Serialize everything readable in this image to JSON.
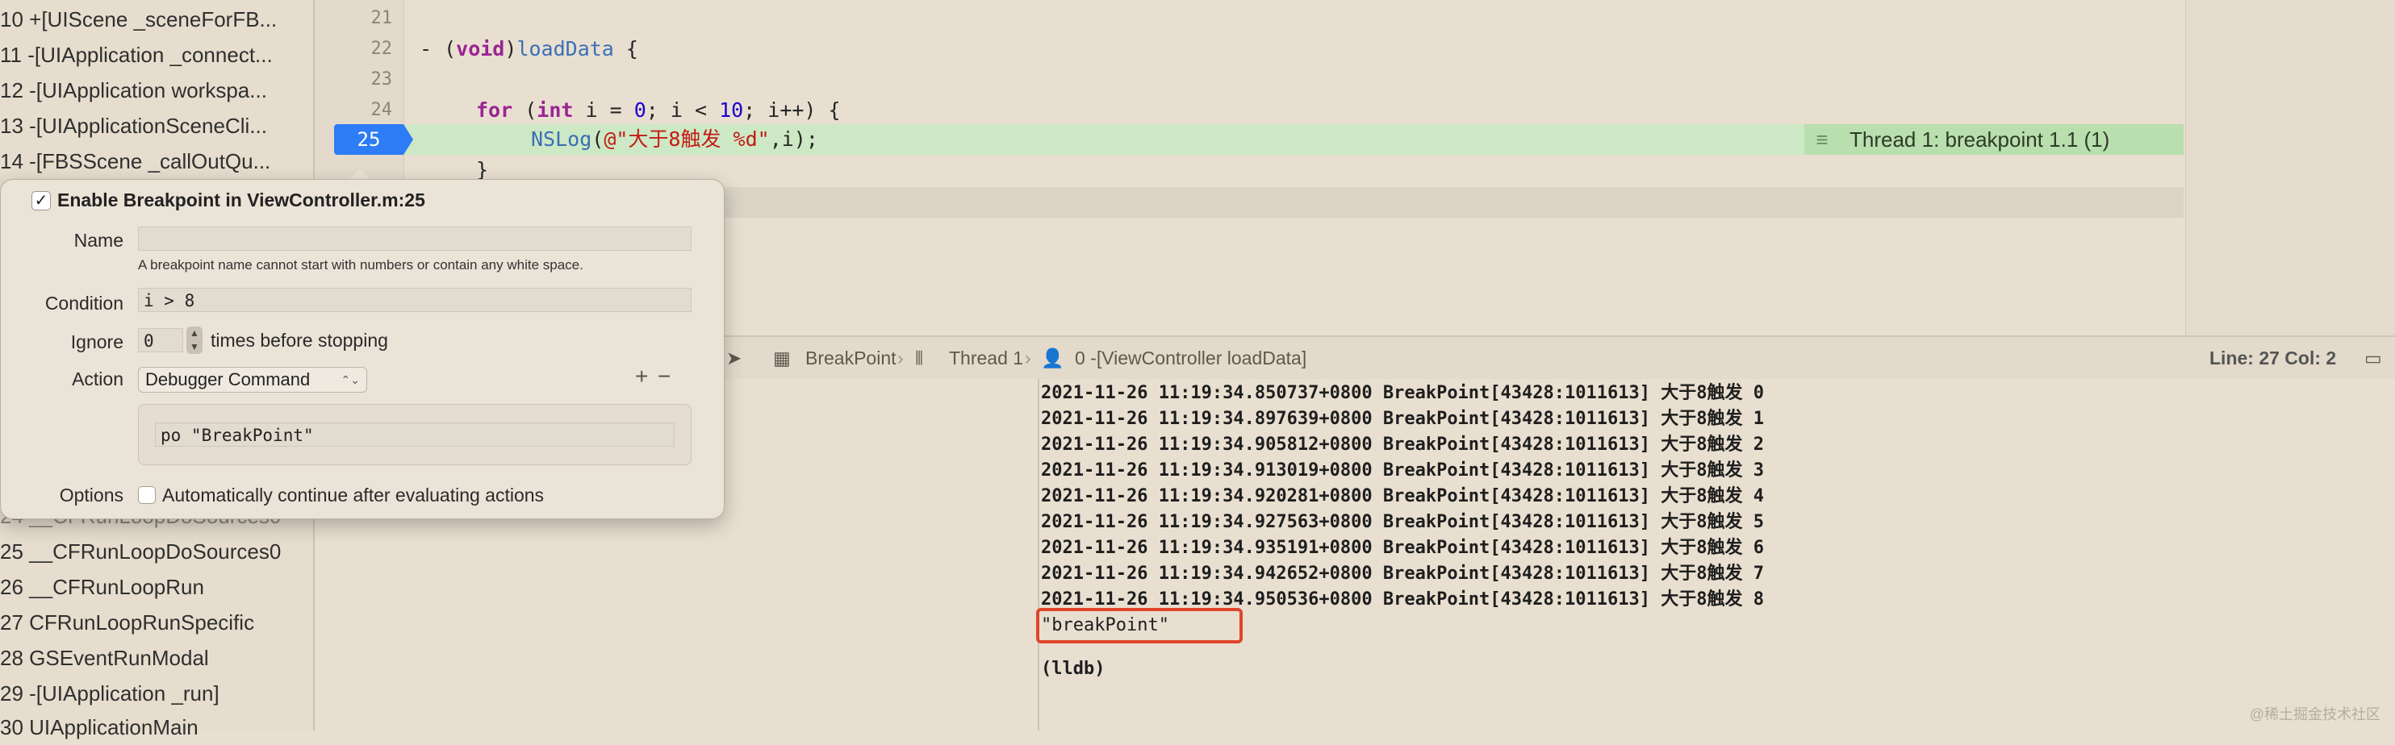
{
  "stack": {
    "frames": [
      "10 +[UIScene _sceneForFB...",
      "11 -[UIApplication _connect...",
      "12 -[UIApplication workspa...",
      "13 -[UIApplicationSceneCli...",
      "14 -[FBSScene _callOutQu...",
      "24 __CFRunLoopDoSources0",
      "25 __CFRunLoopDoSources0",
      "26 __CFRunLoopRun",
      "27 CFRunLoopRunSpecific",
      "28 GSEventRunModal",
      "29 -[UIApplication _run]",
      "30 UIApplicationMain"
    ]
  },
  "editor": {
    "line_numbers": [
      "21",
      "22",
      "23",
      "24",
      "25"
    ],
    "breakpoint_line": "25",
    "code": {
      "l22_open": "- (",
      "l22_void": "void",
      "l22_close": ")",
      "l22_method": "loadData",
      "l22_brace": " {",
      "l24_for": "for",
      "l24_open": " (",
      "l24_int": "int",
      "l24_init": " i = ",
      "l24_zero": "0",
      "l24_cond": "; i < ",
      "l24_ten": "10",
      "l24_rest": "; i++) {",
      "l25_fn": "NSLog",
      "l25_open": "(",
      "l25_str": "@\"大于8触发 %d\"",
      "l25_rest": ",i);",
      "l26": "}"
    },
    "thread_annotation": "Thread 1: breakpoint 1.1 (1)"
  },
  "debug_bar": {
    "target": "BreakPoint",
    "thread": "Thread 1",
    "frame": "0 -[ViewController loadData]",
    "cursor": "Line: 27  Col: 2"
  },
  "console": {
    "lines": [
      "2021-11-26 11:19:34.850737+0800 BreakPoint[43428:1011613] 大于8触发 0",
      "2021-11-26 11:19:34.897639+0800 BreakPoint[43428:1011613] 大于8触发 1",
      "2021-11-26 11:19:34.905812+0800 BreakPoint[43428:1011613] 大于8触发 2",
      "2021-11-26 11:19:34.913019+0800 BreakPoint[43428:1011613] 大于8触发 3",
      "2021-11-26 11:19:34.920281+0800 BreakPoint[43428:1011613] 大于8触发 4",
      "2021-11-26 11:19:34.927563+0800 BreakPoint[43428:1011613] 大于8触发 5",
      "2021-11-26 11:19:34.935191+0800 BreakPoint[43428:1011613] 大于8触发 6",
      "2021-11-26 11:19:34.942652+0800 BreakPoint[43428:1011613] 大于8触发 7",
      "2021-11-26 11:19:34.950536+0800 BreakPoint[43428:1011613] 大于8触发 8"
    ],
    "po_output": "\"breakPoint\"",
    "prompt": "(lldb)"
  },
  "popover": {
    "title": "Enable Breakpoint in ViewController.m:25",
    "enabled": true,
    "name_label": "Name",
    "name_value": "",
    "name_hint": "A breakpoint name cannot start with numbers or contain any white space.",
    "condition_label": "Condition",
    "condition_value": "i > 8",
    "ignore_label": "Ignore",
    "ignore_value": "0",
    "ignore_suffix": "times before stopping",
    "action_label": "Action",
    "action_value": "Debugger Command",
    "action_add": "+",
    "action_remove": "−",
    "command_value": "po \"BreakPoint\"",
    "options_label": "Options",
    "options_text": "Automatically continue after evaluating actions",
    "auto_continue": false
  },
  "watermark": "@稀土掘金技术社区",
  "colors": {
    "breakpoint_blue": "#2e7cf6",
    "breakpoint_line_green": "#cde8c4",
    "highlight_red": "#e0452c"
  }
}
